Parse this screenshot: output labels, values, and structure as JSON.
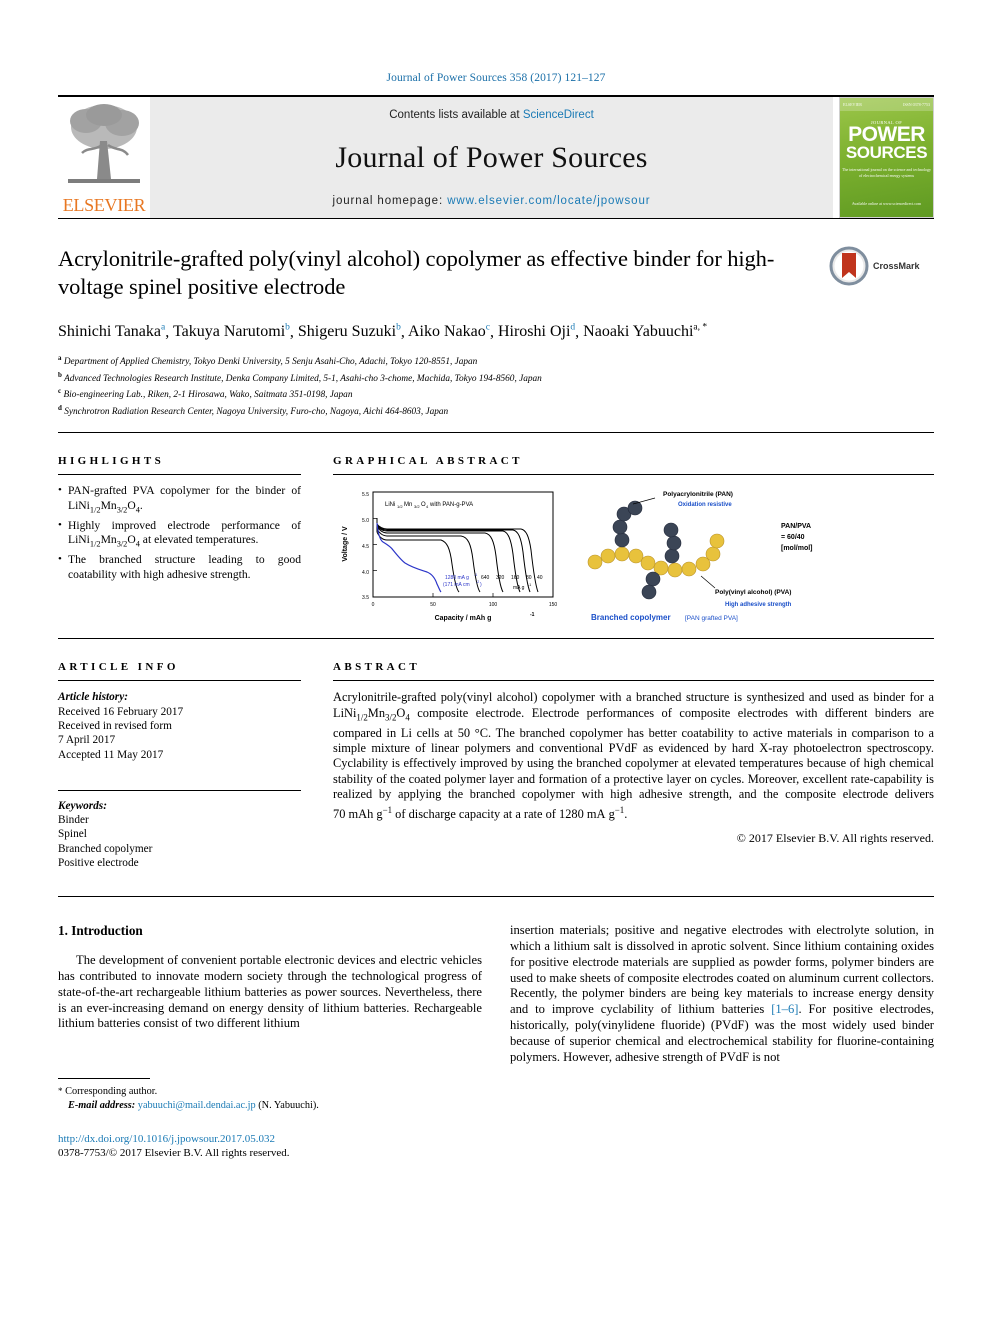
{
  "running_head": "Journal of Power Sources 358 (2017) 121–127",
  "masthead": {
    "contents_prefix": "Contents lists available at ",
    "contents_link": "ScienceDirect",
    "journal_title": "Journal of Power Sources",
    "homepage_prefix": "journal homepage: ",
    "homepage_url": "www.elsevier.com/locate/jpowsour",
    "publisher": "ELSEVIER",
    "cover": {
      "eyebrow": "JOURNAL OF",
      "line1": "POWER",
      "line2": "SOURCES",
      "subline": "The international journal on the science and technology of electrochemical energy systems",
      "footline": "Available online at\nwww.sciencedirect.com"
    }
  },
  "article": {
    "title": "Acrylonitrile-grafted poly(vinyl alcohol) copolymer as effective binder for high-voltage spinel positive electrode",
    "crossmark_label": "CrossMark",
    "authors": [
      {
        "name": "Shinichi Tanaka",
        "marks": "a"
      },
      {
        "name": "Takuya Narutomi",
        "marks": "b"
      },
      {
        "name": "Shigeru Suzuki",
        "marks": "b"
      },
      {
        "name": "Aiko Nakao",
        "marks": "c"
      },
      {
        "name": "Hiroshi Oji",
        "marks": "d"
      },
      {
        "name": "Naoaki Yabuuchi",
        "marks": "a, *"
      }
    ],
    "affiliations": [
      {
        "mark": "a",
        "text": "Department of Applied Chemistry, Tokyo Denki University, 5 Senju Asahi-Cho, Adachi, Tokyo 120-8551, Japan"
      },
      {
        "mark": "b",
        "text": "Advanced Technologies Research Institute, Denka Company Limited, 5-1, Asahi-cho 3-chome, Machida, Tokyo 194-8560, Japan"
      },
      {
        "mark": "c",
        "text": "Bio-engineering Lab., Riken, 2-1 Hirosawa, Wako, Saitmata 351-0198, Japan"
      },
      {
        "mark": "d",
        "text": "Synchrotron Radiation Research Center, Nagoya University, Furo-cho, Nagoya, Aichi 464-8603, Japan"
      }
    ]
  },
  "sections": {
    "highlights_heading": "HIGHLIGHTS",
    "graphical_abstract_heading": "GRAPHICAL ABSTRACT",
    "article_info_heading": "ARTICLE INFO",
    "abstract_heading": "ABSTRACT"
  },
  "highlights": [
    "PAN-grafted PVA copolymer for the binder of LiNi1/2Mn3/2O4.",
    "Highly improved electrode performance of LiNi1/2Mn3/2O4 at elevated temperatures.",
    "The branched structure leading to good coatability with high adhesive strength."
  ],
  "article_info": {
    "history_label": "Article history:",
    "history": [
      "Received 16 February 2017",
      "Received in revised form",
      "7 April 2017",
      "Accepted 11 May 2017"
    ],
    "keywords_label": "Keywords:",
    "keywords": [
      "Binder",
      "Spinel",
      "Branched copolymer",
      "Positive electrode"
    ]
  },
  "abstract": {
    "text": "Acrylonitrile-grafted poly(vinyl alcohol) copolymer with a branched structure is synthesized and used as binder for a LiNi1/2Mn3/2O4 composite electrode. Electrode performances of composite electrodes with different binders are compared in Li cells at 50 °C. The branched copolymer has better coatability to active materials in comparison to a simple mixture of linear polymers and conventional PVdF as evidenced by hard X-ray photoelectron spectroscopy. Cyclability is effectively improved by using the branched copolymer at elevated temperatures because of high chemical stability of the coated polymer layer and formation of a protective layer on cycles. Moreover, excellent rate-capability is realized by applying the branched copolymer with high adhesive strength, and the composite electrode delivers 70 mAh g−1 of discharge capacity at a rate of 1280 mA g−1.",
    "copyright": "© 2017 Elsevier B.V. All rights reserved."
  },
  "chart_data": {
    "type": "line",
    "title": "LiNi1/2Mn3/2O4 with PAN-g-PVA",
    "xlabel": "Capacity  /  mAh g−1",
    "ylabel": "Voltage  /  V",
    "xlim": [
      0,
      150
    ],
    "ylim": [
      3.5,
      5.5
    ],
    "xticks": [
      0,
      50,
      100,
      150
    ],
    "yticks": [
      "3.5",
      "4.0",
      "4.5",
      "5.0",
      "5.5"
    ],
    "grid": false,
    "legend_position": "inline-annotations",
    "rate_labels": [
      "1280",
      "640",
      "320",
      "160",
      "80",
      "40"
    ],
    "rate_unit": "mA g−1",
    "highlight_annotation": "1280 mA g−1 (171 mA cm−2)",
    "highlight_color": "#2b35c8",
    "series": [
      {
        "name": "1280 mA g-1",
        "color": "#2b35c8",
        "capacity_end": 70,
        "plateau_voltage": 4.25
      },
      {
        "name": "640 mA g-1",
        "color": "#000000",
        "capacity_end": 88,
        "plateau_voltage": 4.55
      },
      {
        "name": "320 mA g-1",
        "color": "#000000",
        "capacity_end": 104,
        "plateau_voltage": 4.62
      },
      {
        "name": "160 mA g-1",
        "color": "#000000",
        "capacity_end": 116,
        "plateau_voltage": 4.65
      },
      {
        "name": "80 mA g-1",
        "color": "#000000",
        "capacity_end": 127,
        "plateau_voltage": 4.68
      },
      {
        "name": "40 mA g-1",
        "color": "#000000",
        "capacity_end": 133,
        "plateau_voltage": 4.7
      }
    ]
  },
  "graphical_abstract": {
    "pan_label": "Polyacrylonitrile (PAN)",
    "pan_sub": "Oxidation resistive",
    "ratio_line1": "PAN/PVA",
    "ratio_line2": "= 60/40",
    "ratio_line3": "[mol/mol]",
    "pva_label": "Poly(vinyl alcohol) (PVA)",
    "pva_sub": "High adhesive strength",
    "caption_bold": "Branched copolymer",
    "caption_rest": "[PAN grafted PVA]",
    "pan_color": "#3b4556",
    "pva_color": "#e8c23c",
    "accent_color": "#1a4fc8"
  },
  "body": {
    "intro_heading": "1. Introduction",
    "left_paragraph": "The development of convenient portable electronic devices and electric vehicles has contributed to innovate modern society through the technological progress of state-of-the-art rechargeable lithium batteries as power sources. Nevertheless, there is an ever-increasing demand on energy density of lithium batteries. Rechargeable lithium batteries consist of two different lithium",
    "right_paragraph_part1": "insertion materials; positive and negative electrodes with electrolyte solution, in which a lithium salt is dissolved in aprotic solvent. Since lithium containing oxides for positive electrode materials are supplied as powder forms, polymer binders are used to make sheets of composite electrodes coated on aluminum current collectors. Recently, the polymer binders are being key materials to increase energy density and to improve cyclability of lithium batteries ",
    "right_citation": "[1–6]",
    "right_paragraph_part2": ". For positive electrodes, historically, poly(vinylidene fluoride) (PVdF) was the most widely used binder because of superior chemical and electrochemical stability for fluorine-containing polymers. However, adhesive strength of PVdF is not"
  },
  "footer": {
    "corresponding_star": "*",
    "corresponding_label": "Corresponding author.",
    "email_label": "E-mail address:",
    "email": "yabuuchi@mail.dendai.ac.jp",
    "email_suffix": "(N. Yabuuchi).",
    "doi": "http://dx.doi.org/10.1016/j.jpowsour.2017.05.032",
    "issn_line": "0378-7753/© 2017 Elsevier B.V. All rights reserved."
  }
}
